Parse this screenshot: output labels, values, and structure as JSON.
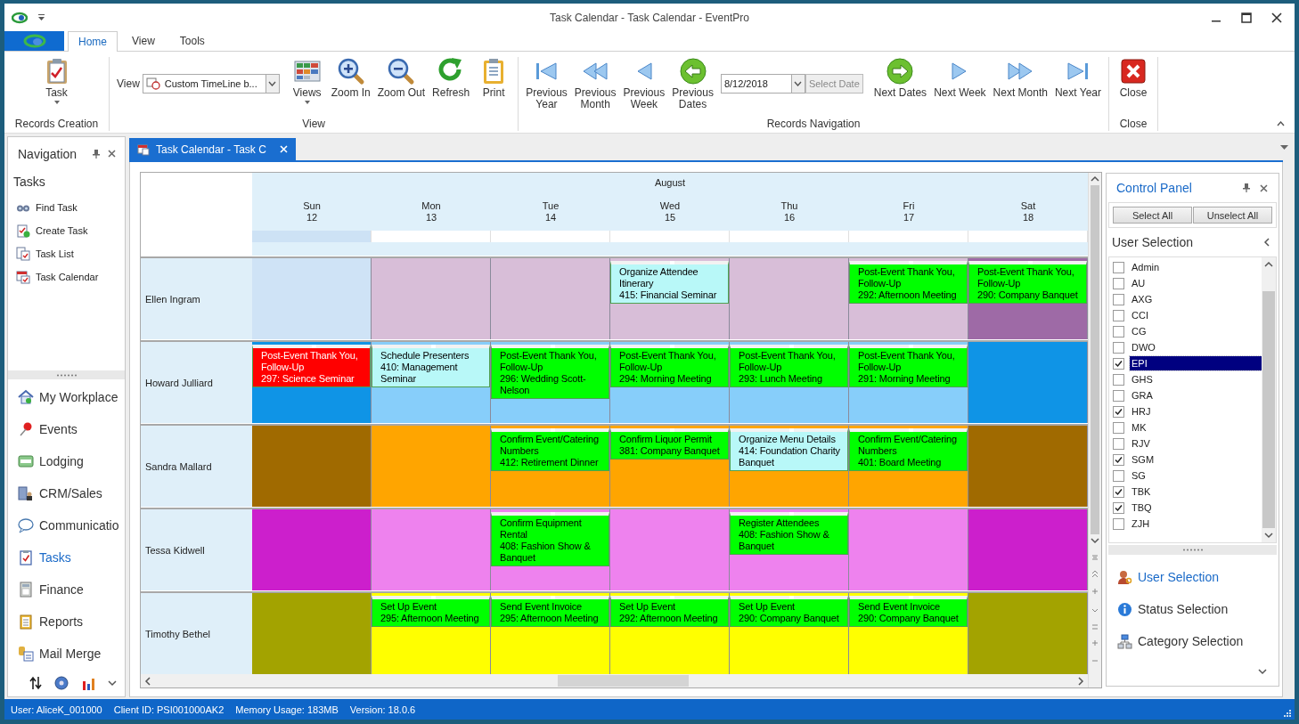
{
  "window": {
    "title": "Task Calendar - Task Calendar - EventPro"
  },
  "ribbon": {
    "tabs": [
      {
        "label": "Home",
        "selected": true
      },
      {
        "label": "View",
        "selected": false
      },
      {
        "label": "Tools",
        "selected": false
      }
    ],
    "groups": [
      {
        "label": "Records Creation",
        "items": [
          {
            "kind": "button",
            "label": "Task",
            "dropdown": true
          }
        ]
      },
      {
        "label": "View",
        "items": [
          {
            "kind": "combo",
            "label": "View",
            "value": "Custom TimeLine b..."
          },
          {
            "kind": "button",
            "label": "Views",
            "dropdown": true
          },
          {
            "kind": "button",
            "label": "Zoom In",
            "dropdown": false
          },
          {
            "kind": "button",
            "label": "Zoom Out",
            "dropdown": false
          },
          {
            "kind": "button",
            "label": "Refresh",
            "dropdown": false
          },
          {
            "kind": "button",
            "label": "Print",
            "dropdown": false
          }
        ]
      },
      {
        "label": "Records Navigation",
        "items": [
          {
            "kind": "button",
            "label": "Previous\nYear",
            "dropdown": false
          },
          {
            "kind": "button",
            "label": "Previous\nMonth",
            "dropdown": false
          },
          {
            "kind": "button",
            "label": "Previous\nWeek",
            "dropdown": false
          },
          {
            "kind": "button",
            "label": "Previous\nDates",
            "dropdown": false
          },
          {
            "kind": "date",
            "value": "8/12/2018",
            "action": "Select Date"
          },
          {
            "kind": "button",
            "label": "Next Dates",
            "dropdown": false
          },
          {
            "kind": "button",
            "label": "Next Week",
            "dropdown": false
          },
          {
            "kind": "button",
            "label": "Next Month",
            "dropdown": false
          },
          {
            "kind": "button",
            "label": "Next Year",
            "dropdown": false
          }
        ]
      },
      {
        "label": "Close",
        "items": [
          {
            "kind": "button",
            "label": "Close",
            "dropdown": false
          }
        ]
      }
    ]
  },
  "navigation": {
    "title": "Navigation",
    "section": "Tasks",
    "items": [
      "Find Task",
      "Create Task",
      "Task List",
      "Task Calendar"
    ],
    "modules": [
      {
        "label": "My Workplace",
        "selected": false
      },
      {
        "label": "Events",
        "selected": false
      },
      {
        "label": "Lodging",
        "selected": false
      },
      {
        "label": "CRM/Sales",
        "selected": false
      },
      {
        "label": "Communicatio",
        "selected": false
      },
      {
        "label": "Tasks",
        "selected": true
      },
      {
        "label": "Finance",
        "selected": false
      },
      {
        "label": "Reports",
        "selected": false
      },
      {
        "label": "Mail Merge",
        "selected": false
      }
    ]
  },
  "document_tab": {
    "label": "Task Calendar - Task C",
    "selected": true
  },
  "calendar": {
    "month": "August",
    "days": [
      {
        "name": "Sun",
        "date": "12",
        "selected": true
      },
      {
        "name": "Mon",
        "date": "13",
        "selected": false
      },
      {
        "name": "Tue",
        "date": "14",
        "selected": false
      },
      {
        "name": "Wed",
        "date": "15",
        "selected": false
      },
      {
        "name": "Thu",
        "date": "16",
        "selected": false
      },
      {
        "name": "Fri",
        "date": "17",
        "selected": false
      },
      {
        "name": "Sat",
        "date": "18",
        "selected": false
      }
    ],
    "resources": [
      {
        "name": "Ellen Ingram",
        "cells": [
          {
            "color": "#cfe3f6"
          },
          {
            "color": "#d8bed8"
          },
          {
            "color": "#d8bed8"
          },
          {
            "color": "#d8bed8",
            "task": {
              "title": "Organize Attendee Itinerary",
              "event": "415: Financial Seminar",
              "color": "#b8f8f8"
            }
          },
          {
            "color": "#d8bed8"
          },
          {
            "color": "#d8bed8",
            "task": {
              "title": "Post-Event Thank You, Follow-Up",
              "event": "292: Afternoon Meeting",
              "color": "#00ff00"
            }
          },
          {
            "color": "#9e6aa6",
            "task": {
              "title": "Post-Event Thank You, Follow-Up",
              "event": "290: Company Banquet",
              "color": "#00ff00"
            }
          }
        ]
      },
      {
        "name": "Howard Julliard",
        "cells": [
          {
            "color": "#0f94e6",
            "task": {
              "title": "Post-Event Thank You, Follow-Up",
              "event": "297: Science Seminar",
              "color": "#ff0000"
            }
          },
          {
            "color": "#87cefa",
            "task": {
              "title": "Schedule Presenters",
              "event": "410: Management Seminar",
              "color": "#b8f8f8"
            }
          },
          {
            "color": "#87cefa",
            "task": {
              "title": "Post-Event Thank You, Follow-Up",
              "event": "296: Wedding Scott-Nelson",
              "color": "#00ff00"
            }
          },
          {
            "color": "#87cefa",
            "task": {
              "title": "Post-Event Thank You, Follow-Up",
              "event": "294: Morning Meeting",
              "color": "#00ff00"
            }
          },
          {
            "color": "#87cefa",
            "task": {
              "title": "Post-Event Thank You, Follow-Up",
              "event": "293: Lunch Meeting",
              "color": "#00ff00"
            }
          },
          {
            "color": "#87cefa",
            "task": {
              "title": "Post-Event Thank You, Follow-Up",
              "event": "291: Morning Meeting",
              "color": "#00ff00"
            }
          },
          {
            "color": "#0f94e6"
          }
        ]
      },
      {
        "name": "Sandra Mallard",
        "cells": [
          {
            "color": "#a06a00"
          },
          {
            "color": "#ffa500"
          },
          {
            "color": "#ffa500",
            "task": {
              "title": "Confirm Event/Catering Numbers",
              "event": "412: Retirement Dinner",
              "color": "#00ff00"
            }
          },
          {
            "color": "#ffa500",
            "task": {
              "title": "Confirm Liquor Permit",
              "event": "381: Company Banquet",
              "color": "#00ff00"
            }
          },
          {
            "color": "#ffa500",
            "task": {
              "title": "Organize Menu Details",
              "event": "414: Foundation Charity Banquet",
              "color": "#b8f8f8"
            }
          },
          {
            "color": "#ffa500",
            "task": {
              "title": "Confirm Event/Catering Numbers",
              "event": "401: Board Meeting",
              "color": "#00ff00"
            }
          },
          {
            "color": "#a06a00"
          }
        ]
      },
      {
        "name": "Tessa Kidwell",
        "cells": [
          {
            "color": "#cc1fcc"
          },
          {
            "color": "#ee82ee"
          },
          {
            "color": "#ee82ee",
            "task": {
              "title": "Confirm Equipment Rental",
              "event": "408: Fashion Show & Banquet",
              "color": "#00ff00"
            }
          },
          {
            "color": "#ee82ee"
          },
          {
            "color": "#ee82ee",
            "task": {
              "title": "Register Attendees",
              "event": "408: Fashion Show & Banquet",
              "color": "#00ff00"
            }
          },
          {
            "color": "#ee82ee"
          },
          {
            "color": "#cc1fcc"
          }
        ]
      },
      {
        "name": "Timothy Bethel",
        "cells": [
          {
            "color": "#a3a300"
          },
          {
            "color": "#ffff00",
            "task": {
              "title": "Set Up Event",
              "event": "295: Afternoon Meeting",
              "color": "#00ff00"
            }
          },
          {
            "color": "#ffff00",
            "task": {
              "title": "Send Event Invoice",
              "event": "295: Afternoon Meeting",
              "color": "#00ff00"
            }
          },
          {
            "color": "#ffff00",
            "task": {
              "title": "Set Up Event",
              "event": "292: Afternoon Meeting",
              "color": "#00ff00"
            }
          },
          {
            "color": "#ffff00",
            "task": {
              "title": "Set Up Event",
              "event": "290: Company Banquet",
              "color": "#00ff00"
            }
          },
          {
            "color": "#ffff00",
            "task": {
              "title": "Send Event Invoice",
              "event": "290: Company Banquet",
              "color": "#00ff00"
            }
          },
          {
            "color": "#a3a300"
          }
        ]
      }
    ]
  },
  "control_panel": {
    "title": "Control Panel",
    "buttons": [
      "Select All",
      "Unselect All"
    ],
    "section": "User Selection",
    "users": [
      {
        "label": "Admin",
        "checked": false,
        "selected": false
      },
      {
        "label": "AU",
        "checked": false,
        "selected": false
      },
      {
        "label": "AXG",
        "checked": false,
        "selected": false
      },
      {
        "label": "CCI",
        "checked": false,
        "selected": false
      },
      {
        "label": "CG",
        "checked": false,
        "selected": false
      },
      {
        "label": "DWO",
        "checked": false,
        "selected": false
      },
      {
        "label": "EPI",
        "checked": true,
        "selected": true
      },
      {
        "label": "GHS",
        "checked": false,
        "selected": false
      },
      {
        "label": "GRA",
        "checked": false,
        "selected": false
      },
      {
        "label": "HRJ",
        "checked": true,
        "selected": false
      },
      {
        "label": "MK",
        "checked": false,
        "selected": false
      },
      {
        "label": "RJV",
        "checked": false,
        "selected": false
      },
      {
        "label": "SGM",
        "checked": true,
        "selected": false
      },
      {
        "label": "SG",
        "checked": false,
        "selected": false
      },
      {
        "label": "TBK",
        "checked": true,
        "selected": false
      },
      {
        "label": "TBQ",
        "checked": true,
        "selected": false
      },
      {
        "label": "ZJH",
        "checked": false,
        "selected": false
      }
    ],
    "pages": [
      {
        "label": "User Selection",
        "selected": true
      },
      {
        "label": "Status Selection",
        "selected": false
      },
      {
        "label": "Category Selection",
        "selected": false
      }
    ]
  },
  "status_bar": [
    "User: AliceK_001000",
    "Client ID: PSI001000AK2",
    "Memory Usage: 183MB",
    "Version: 18.0.6"
  ]
}
